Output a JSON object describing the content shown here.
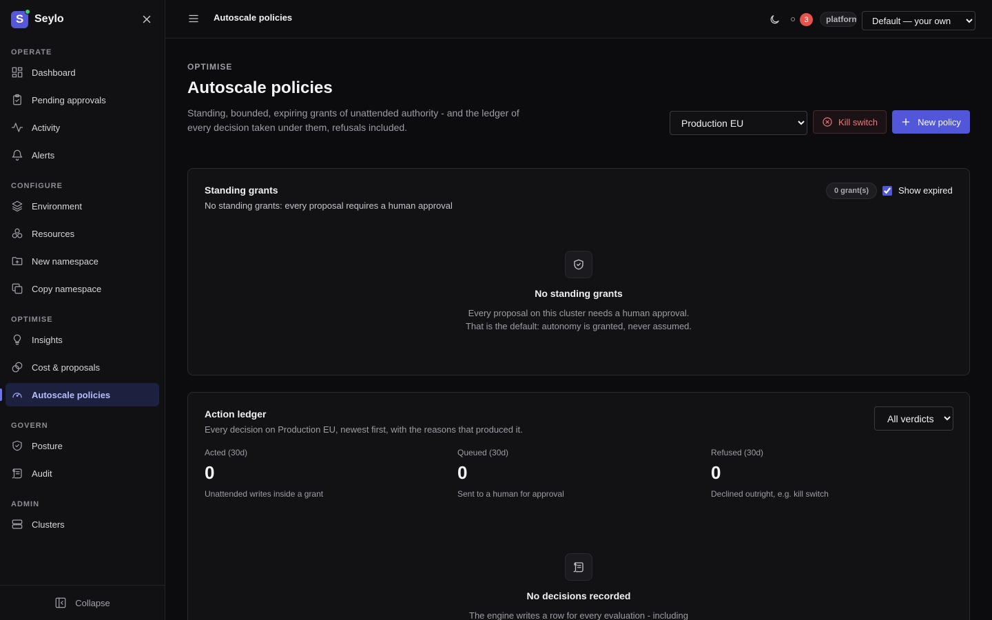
{
  "app": {
    "name": "Seylo"
  },
  "sidebar": {
    "sections": {
      "operate": "OPERATE",
      "configure": "CONFIGURE",
      "optimise": "OPTIMISE",
      "govern": "GOVERN",
      "admin": "ADMIN"
    },
    "items": {
      "dashboard": "Dashboard",
      "pending_approvals": "Pending approvals",
      "activity": "Activity",
      "alerts": "Alerts",
      "environment": "Environment",
      "resources": "Resources",
      "new_namespace": "New namespace",
      "copy_namespace": "Copy namespace",
      "insights": "Insights",
      "cost_proposals": "Cost & proposals",
      "autoscale_policies": "Autoscale policies",
      "posture": "Posture",
      "audit": "Audit",
      "clusters": "Clusters"
    },
    "collapse_label": "Collapse"
  },
  "topbar": {
    "title": "Autoscale policies",
    "notifications_count": "3",
    "user": "platform",
    "namespace_selected": "Default — your own"
  },
  "header": {
    "eyebrow": "OPTIMISE",
    "title": "Autoscale policies",
    "description": "Standing, bounded, expiring grants of unattended authority - and the ledger of every decision taken under them, refusals included.",
    "environment_selected": "Production EU",
    "kill_switch_label": "Kill switch",
    "new_policy_label": "New policy"
  },
  "grants": {
    "title": "Standing grants",
    "subtitle": "No standing grants: every proposal requires a human approval",
    "count_badge": "0 grant(s)",
    "show_expired_label": "Show expired",
    "show_expired_checked": true,
    "empty_title": "No standing grants",
    "empty_line1": "Every proposal on this cluster needs a human approval.",
    "empty_line2": "That is the default: autonomy is granted, never assumed."
  },
  "ledger": {
    "title": "Action ledger",
    "subtitle": "Every decision on Production EU, newest first, with the reasons that produced it.",
    "verdict_filter": "All verdicts",
    "stats": [
      {
        "label": "Acted (30d)",
        "value": "0",
        "note": "Unattended writes inside a grant"
      },
      {
        "label": "Queued (30d)",
        "value": "0",
        "note": "Sent to a human for approval"
      },
      {
        "label": "Refused (30d)",
        "value": "0",
        "note": "Declined outright, e.g. kill switch"
      }
    ],
    "empty_title": "No decisions recorded",
    "empty_line1": "The engine writes a row for every evaluation - including"
  },
  "colors": {
    "accent": "#5257d9",
    "danger": "#f0777a",
    "badge": "#e5534b",
    "status_online": "#3fd07a"
  }
}
